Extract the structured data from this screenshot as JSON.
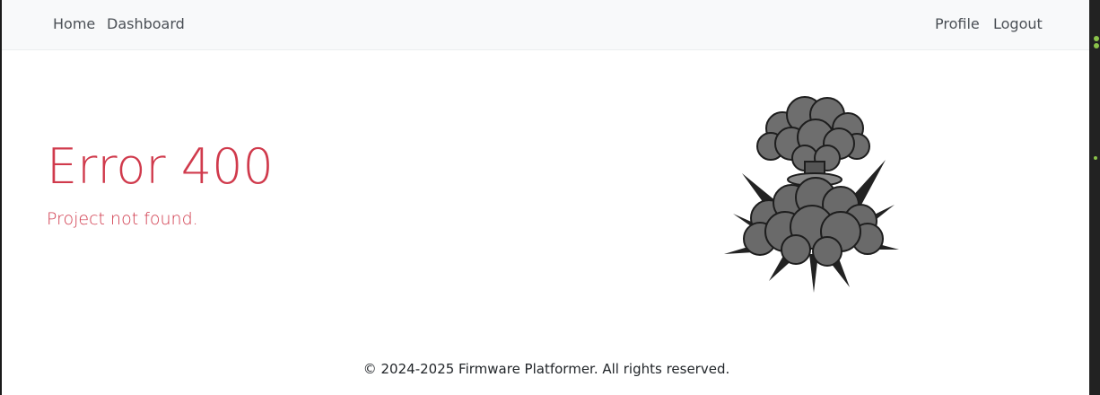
{
  "nav": {
    "left": [
      {
        "label": "Home"
      },
      {
        "label": "Dashboard"
      }
    ],
    "right": [
      {
        "label": "Profile"
      },
      {
        "label": "Logout"
      }
    ]
  },
  "error": {
    "title": "Error 400",
    "message": "Project not found."
  },
  "image": {
    "icon": "explosion-illustration"
  },
  "footer": {
    "text": "© 2024-2025 Firmware Platformer. All rights reserved."
  },
  "colors": {
    "error": "#d03a4c",
    "navbar_bg": "#f8f9fa",
    "nav_text": "#4a4f55"
  }
}
